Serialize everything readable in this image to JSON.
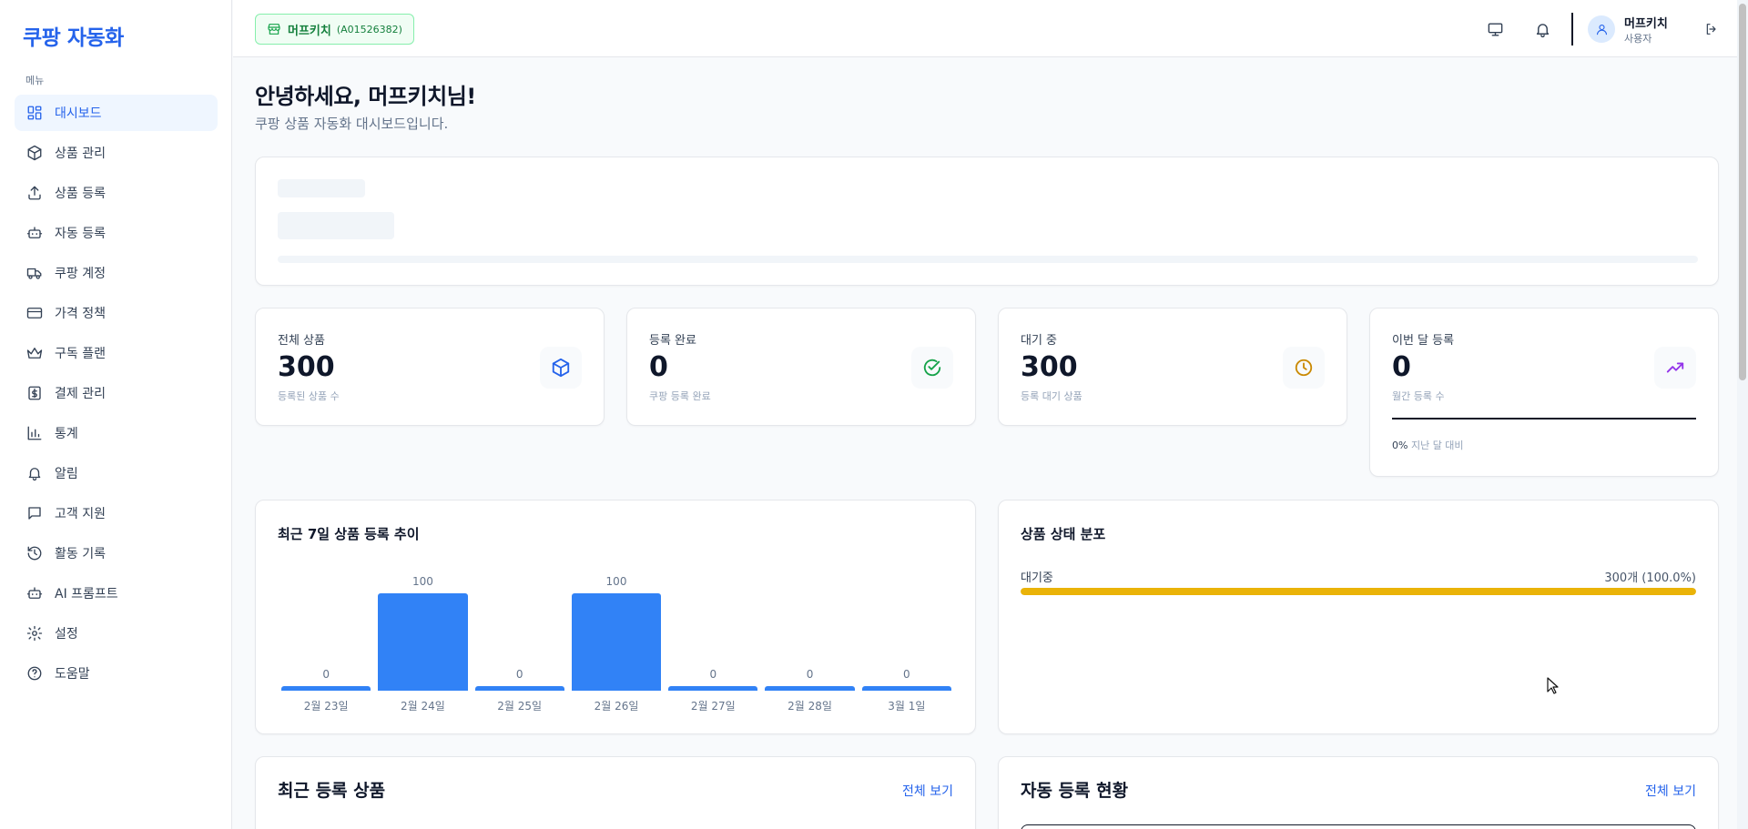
{
  "brand": "쿠팡 자동화",
  "menu_caption": "메뉴",
  "nav": [
    {
      "label": "대시보드",
      "icon": "dashboard-icon"
    },
    {
      "label": "상품 관리",
      "icon": "package-icon"
    },
    {
      "label": "상품 등록",
      "icon": "upload-icon"
    },
    {
      "label": "자동 등록",
      "icon": "bot-icon"
    },
    {
      "label": "쿠팡 계정",
      "icon": "truck-icon"
    },
    {
      "label": "가격 정책",
      "icon": "credit-card-icon"
    },
    {
      "label": "구독 플랜",
      "icon": "crown-icon"
    },
    {
      "label": "결제 관리",
      "icon": "dollar-icon"
    },
    {
      "label": "통계",
      "icon": "bar-chart-icon"
    },
    {
      "label": "알림",
      "icon": "bell-icon"
    },
    {
      "label": "고객 지원",
      "icon": "message-icon"
    },
    {
      "label": "활동 기록",
      "icon": "history-icon"
    },
    {
      "label": "AI 프롬프트",
      "icon": "bot-icon"
    },
    {
      "label": "설정",
      "icon": "gear-icon"
    },
    {
      "label": "도움말",
      "icon": "help-icon"
    }
  ],
  "header": {
    "store_name": "머프키치",
    "store_code": "(A01526382)",
    "user_name": "머프키치",
    "user_role": "사용자"
  },
  "greeting": "안녕하세요, 머프키치님!",
  "subtitle": "쿠팡 상품 자동화 대시보드입니다.",
  "stats": [
    {
      "label": "전체 상품",
      "value": "300",
      "sub": "등록된 상품 수",
      "icon": "package-icon",
      "color": "#2563eb"
    },
    {
      "label": "등록 완료",
      "value": "0",
      "sub": "쿠팡 등록 완료",
      "icon": "check-circle-icon",
      "color": "#16a34a"
    },
    {
      "label": "대기 중",
      "value": "300",
      "sub": "등록 대기 상품",
      "icon": "clock-icon",
      "color": "#ca8a04"
    },
    {
      "label": "이번 달 등록",
      "value": "0",
      "sub": "월간 등록 수",
      "icon": "trending-up-icon",
      "color": "#9333ea",
      "trend_value": "0%",
      "trend_text": "지난 달 대비"
    }
  ],
  "trend_chart": {
    "title": "최근 7일 상품 등록 추이"
  },
  "chart_data": {
    "type": "bar",
    "title": "최근 7일 상품 등록 추이",
    "categories": [
      "2월 23일",
      "2월 24일",
      "2월 25일",
      "2월 26일",
      "2월 27일",
      "2월 28일",
      "3월 1일"
    ],
    "values": [
      0,
      100,
      0,
      100,
      0,
      0,
      0
    ],
    "ylim": [
      0,
      100
    ],
    "color": "#3182f6"
  },
  "distribution": {
    "title": "상품 상태 분포",
    "label": "대기중",
    "count": "300개 (100.0%)",
    "fraction": 1.0,
    "color": "#eab308"
  },
  "recent": {
    "title": "최근 등록 상품",
    "view_all": "전체 보기"
  },
  "auto": {
    "title": "자동 등록 현황",
    "view_all": "전체 보기"
  }
}
